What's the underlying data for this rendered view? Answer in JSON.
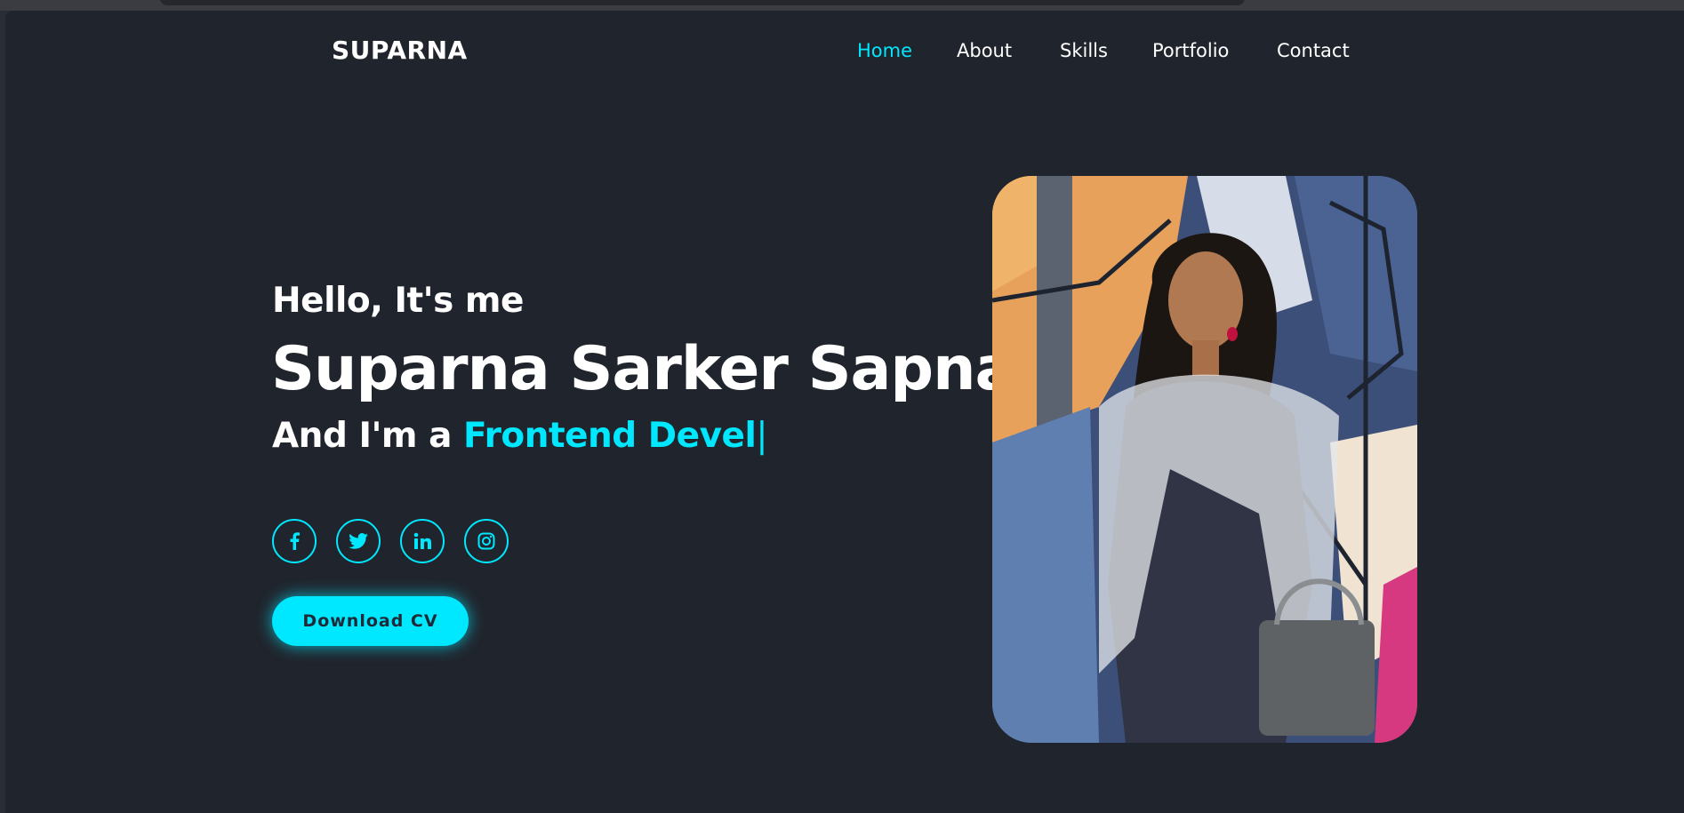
{
  "brand": "SUPARNA",
  "nav": {
    "items": [
      "Home",
      "About",
      "Skills",
      "Portfolio",
      "Contact"
    ],
    "active": "Home"
  },
  "hero": {
    "greeting": "Hello, It's me",
    "name": "Suparna Sarker Sapna",
    "role_prefix": "And I'm a ",
    "role_typed": "Frontend Devel",
    "cursor": "|",
    "cta_label": "Download CV"
  },
  "socials": [
    {
      "icon": "facebook-icon"
    },
    {
      "icon": "twitter-icon"
    },
    {
      "icon": "linkedin-icon"
    },
    {
      "icon": "instagram-icon"
    }
  ],
  "colors": {
    "accent": "#00e8ff",
    "background": "#20242c",
    "text": "#ffffff"
  }
}
